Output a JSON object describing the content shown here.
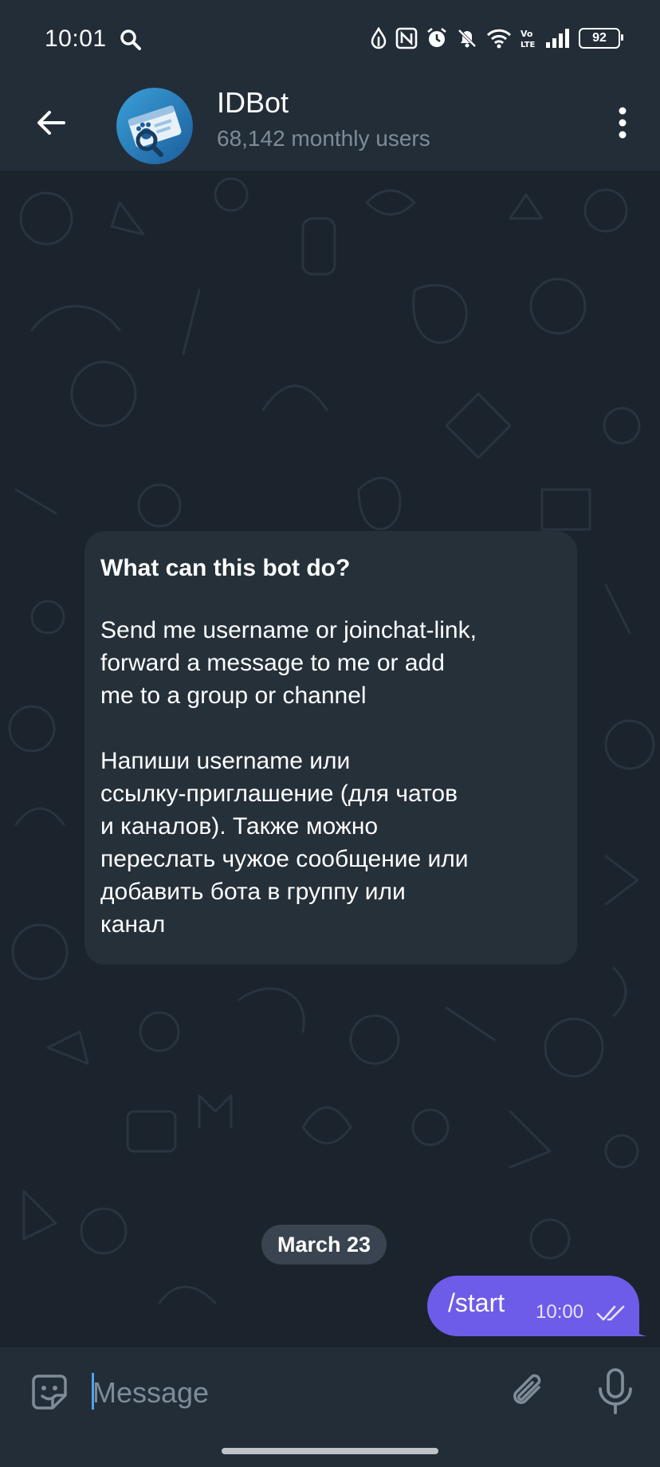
{
  "status_bar": {
    "time": "10:01",
    "battery": "92",
    "network_label": "Vo LTE",
    "icons": [
      "search-icon",
      "data-saver-icon",
      "nfc-icon",
      "alarm-icon",
      "mute-icon",
      "wifi-icon",
      "volte-icon",
      "signal-icon",
      "battery-icon"
    ]
  },
  "header": {
    "title": "IDBot",
    "subtitle": "68,142 monthly users",
    "back_icon": "arrow-left-icon",
    "menu_icon": "more-vertical-icon"
  },
  "intro": {
    "title": "What can this bot do?",
    "paragraph_en": "Send me username or joinchat-link,\nforward a message to me or add\nme to a group or channel",
    "paragraph_ru": "Напиши username или\nссылку-приглашение (для чатов\nи каналов). Также можно\nпереслать чужое сообщение или\nдобавить бота в группу или\nканал"
  },
  "date_separator": "March 23",
  "messages": [
    {
      "text": "/start",
      "time": "10:00",
      "status": "read"
    }
  ],
  "input": {
    "placeholder": "Message"
  },
  "colors": {
    "background": "#1b232c",
    "bar": "#222d38",
    "card": "#253039",
    "outgoing": "#6d5ce8",
    "muted": "#7f8b97"
  }
}
